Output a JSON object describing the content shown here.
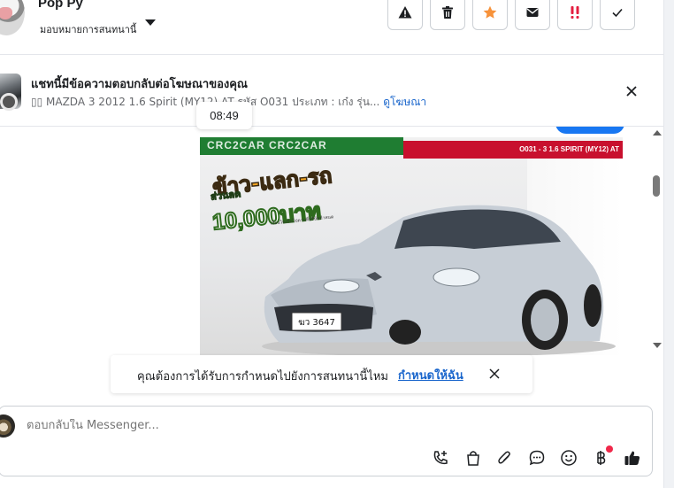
{
  "header": {
    "user_name": "Pop Py",
    "assign_label": "มอบหมายการสนทนานี้",
    "toolbar": [
      {
        "name": "report-button",
        "icon": "warning-icon"
      },
      {
        "name": "delete-button",
        "icon": "trash-icon"
      },
      {
        "name": "star-button",
        "icon": "star-icon",
        "color": "#f7923a"
      },
      {
        "name": "mark-unread-button",
        "icon": "envelope-icon"
      },
      {
        "name": "follow-up-button",
        "icon": "exclamation-icon",
        "color": "#e41e3f"
      },
      {
        "name": "done-button",
        "icon": "check-icon"
      }
    ]
  },
  "ad_reference": {
    "title": "แชทนี้มีข้อความตอบกลับต่อโฆษณาของคุณ",
    "description": "▯▯ MAZDA 3 2012 1.6 Spirit (MY12) AT รหัส O031 ประเภท : เก๋ง รุ่น...",
    "link": "ดูโฆษณา"
  },
  "timestamp_tooltip": "08:49",
  "ad_image": {
    "green_banner": "CRC2CAR CRC2CAR",
    "red_banner": "O031 - 3 1.6 SPIRIT (MY12) AT",
    "promo_line1": "ข้าว-แลก-รถ",
    "promo_small": "ส่วนลด",
    "promo_big": "10,000บาท",
    "promo_fine": "เงื่อนไขเป็นไปตามที่บริษัทกำหนด",
    "plate": "ฆว 3647"
  },
  "prompt": {
    "text": "คุณต้องการได้รับการกำหนดไปยังการสนทนานี้ไหม",
    "action": "กำหนดให้ฉัน"
  },
  "composer": {
    "placeholder": "ตอบกลับใน Messenger...",
    "tools": [
      "add-call-icon",
      "shopping-bag-icon",
      "paperclip-icon",
      "chat-bubble-icon",
      "emoji-icon",
      "baht-icon",
      "thumbs-up-icon"
    ]
  },
  "colors": {
    "link_blue": "#1a66cc",
    "messenger_blue": "#1877f2",
    "star_orange": "#f7923a",
    "alert_red": "#e41e3f"
  }
}
